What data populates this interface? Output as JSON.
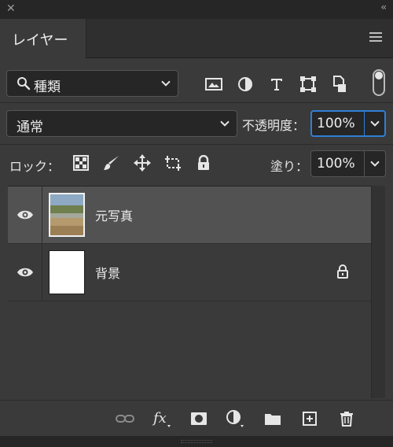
{
  "window": {
    "close_glyph": "✕",
    "collapse_glyph": "‹‹"
  },
  "panel": {
    "tab_label": "レイヤー",
    "menu_icon": "menu-icon"
  },
  "filter": {
    "kind_label": "種類",
    "search_icon": "search-icon",
    "icons": [
      "image-icon",
      "adjustment-icon",
      "text-icon",
      "shape-icon",
      "smart-object-icon"
    ],
    "toggle_state": "on"
  },
  "blend": {
    "mode": "通常",
    "opacity_label": "不透明度：",
    "opacity_value": "100%"
  },
  "lock": {
    "label": "ロック：",
    "icons": [
      "lock-transparency-icon",
      "lock-pixels-icon",
      "lock-position-icon",
      "lock-artboard-icon",
      "lock-all-icon"
    ],
    "fill_label": "塗り：",
    "fill_value": "100%"
  },
  "layers": [
    {
      "name": "元写真",
      "visible": true,
      "selected": true,
      "thumb": "photo",
      "locked": false
    },
    {
      "name": "背景",
      "visible": true,
      "selected": false,
      "thumb": "white",
      "locked": true
    }
  ],
  "footer_icons": [
    "link-icon",
    "fx-icon",
    "mask-icon",
    "adjustment-layer-icon",
    "folder-icon",
    "new-layer-icon",
    "trash-icon"
  ],
  "colors": {
    "panel_bg": "#3a3a3a",
    "selected_row": "#525252",
    "focus_border": "#2f7fd6"
  }
}
